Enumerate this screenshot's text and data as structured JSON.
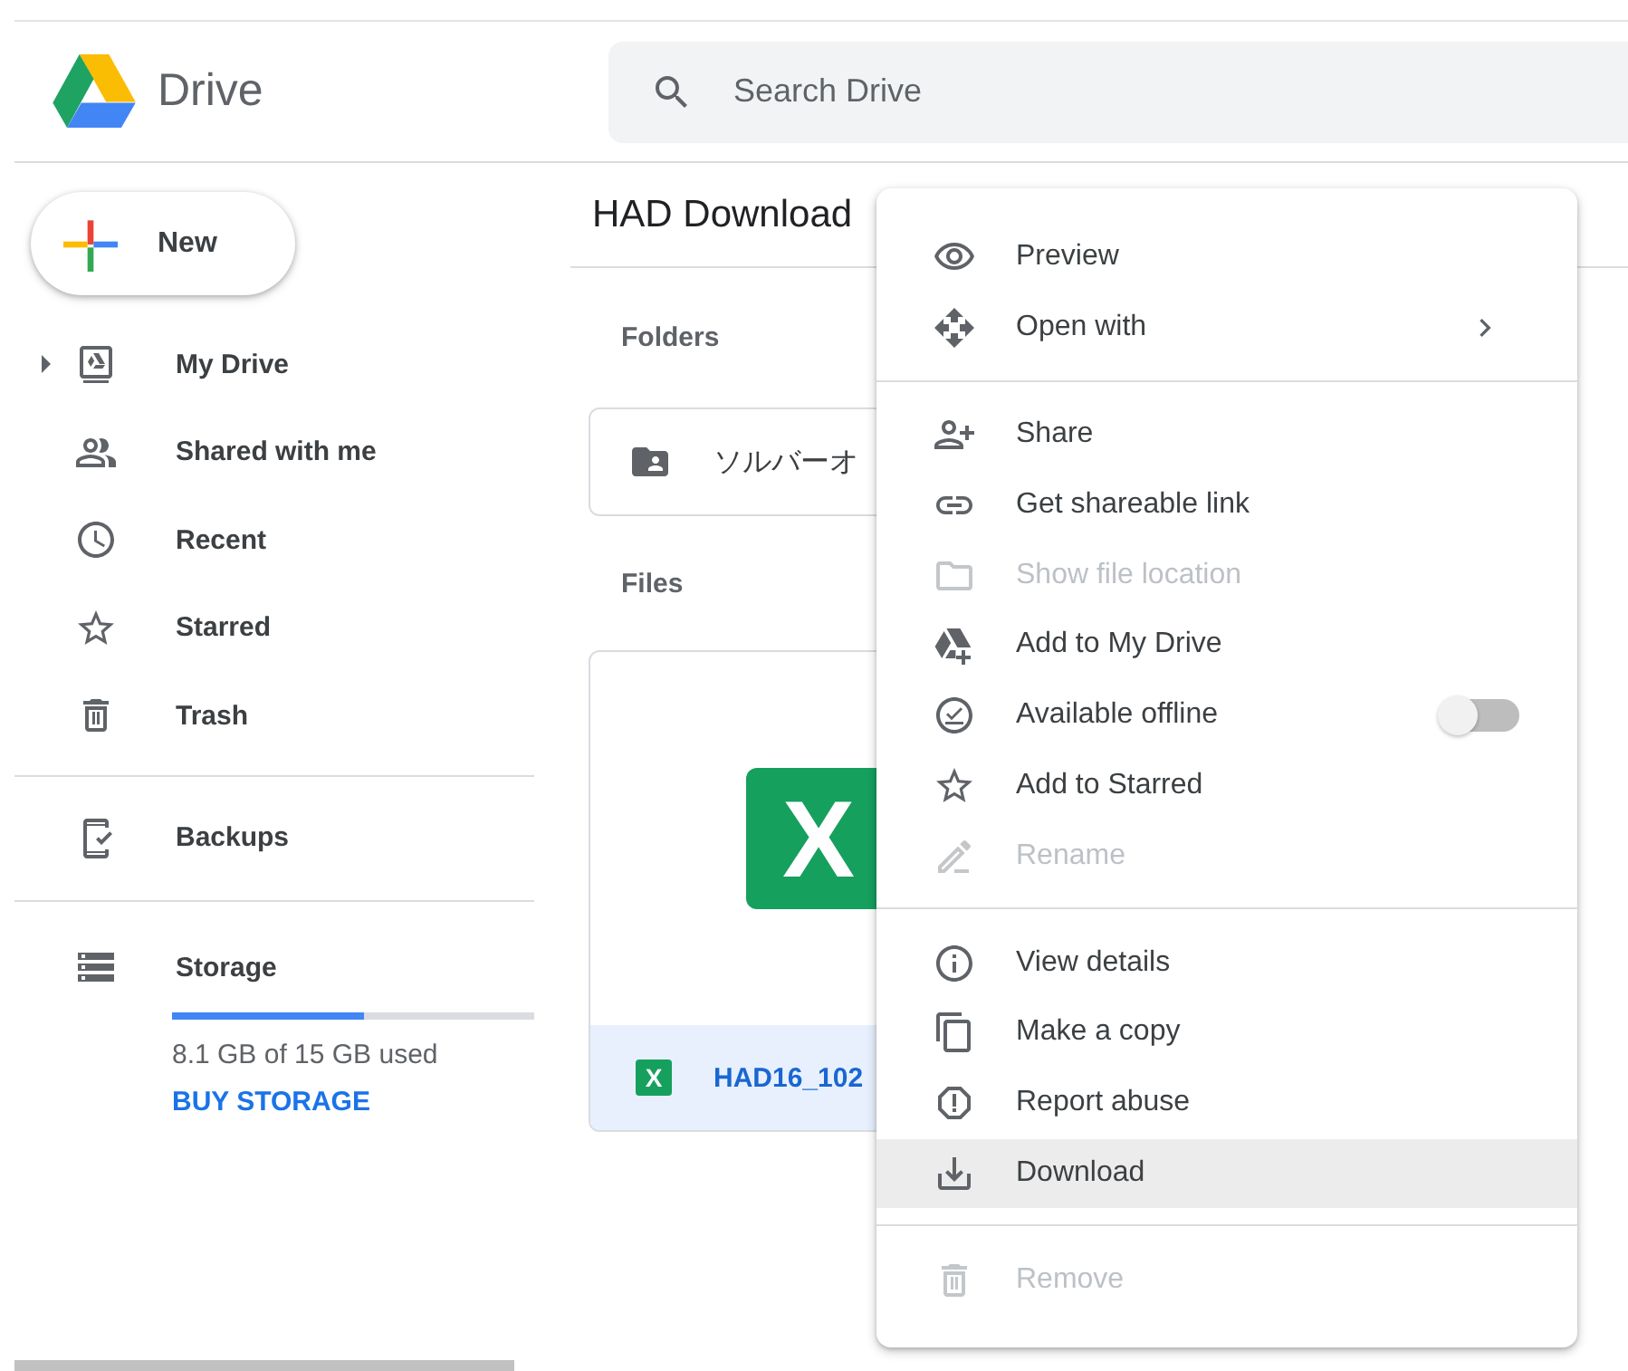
{
  "app": {
    "name": "Drive"
  },
  "search": {
    "placeholder": "Search Drive"
  },
  "new_button": {
    "label": "New"
  },
  "sidebar": {
    "groups": [
      {
        "items": [
          {
            "label": "My Drive",
            "selected": false,
            "expanded": false
          },
          {
            "label": "Shared with me",
            "selected": false
          },
          {
            "label": "Recent",
            "selected": false
          },
          {
            "label": "Starred",
            "selected": false
          },
          {
            "label": "Trash",
            "selected": false
          }
        ]
      },
      {
        "items": [
          {
            "label": "Backups",
            "selected": false
          }
        ]
      }
    ]
  },
  "storage": {
    "label": "Storage",
    "level": 0.53,
    "usage": "8.1 GB of 15 GB used",
    "link": "BUY STORAGE"
  },
  "main": {
    "title": "HAD Download",
    "folders_heading": "Folders",
    "folders": [
      {
        "name": "ソルバーオ"
      }
    ],
    "files_heading": "Files",
    "files": [
      {
        "name": "HAD16_102",
        "thumbnail_label": "X",
        "type_label": "X",
        "selected": true
      }
    ]
  },
  "context_menu": {
    "groups": [
      {
        "items": [
          {
            "label": "Preview",
            "kind": "action",
            "disabled": false,
            "highlighted": false,
            "submenu": false
          },
          {
            "label": "Open with",
            "kind": "action",
            "disabled": false,
            "highlighted": false,
            "submenu": true
          }
        ]
      },
      {
        "items": [
          {
            "label": "Share",
            "kind": "action",
            "disabled": false,
            "highlighted": false,
            "submenu": false
          },
          {
            "label": "Get shareable link",
            "kind": "action",
            "disabled": false,
            "highlighted": false,
            "submenu": false
          },
          {
            "label": "Show file location",
            "kind": "action",
            "disabled": true,
            "highlighted": false,
            "submenu": false
          },
          {
            "label": "Add to My Drive",
            "kind": "action",
            "disabled": false,
            "highlighted": false,
            "submenu": false
          },
          {
            "label": "Available offline",
            "kind": "toggle",
            "on": false,
            "disabled": false,
            "highlighted": false,
            "submenu": false
          },
          {
            "label": "Add to Starred",
            "kind": "action",
            "disabled": false,
            "highlighted": false,
            "submenu": false
          },
          {
            "label": "Rename",
            "kind": "action",
            "disabled": true,
            "highlighted": false,
            "submenu": false
          }
        ]
      },
      {
        "items": [
          {
            "label": "View details",
            "kind": "action",
            "disabled": false,
            "highlighted": false,
            "submenu": false
          },
          {
            "label": "Make a copy",
            "kind": "action",
            "disabled": false,
            "highlighted": false,
            "submenu": false
          },
          {
            "label": "Report abuse",
            "kind": "action",
            "disabled": false,
            "highlighted": false,
            "submenu": false
          },
          {
            "label": "Download",
            "kind": "action",
            "disabled": false,
            "highlighted": true,
            "submenu": false
          }
        ]
      },
      {
        "items": [
          {
            "label": "Remove",
            "kind": "action",
            "disabled": true,
            "highlighted": false,
            "submenu": false
          }
        ]
      }
    ]
  }
}
